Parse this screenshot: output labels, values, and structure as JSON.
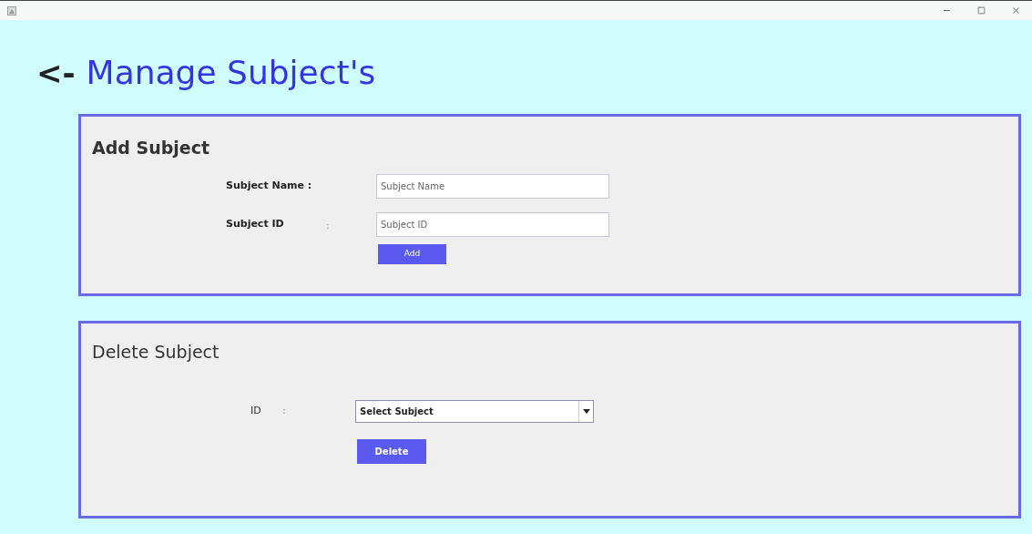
{
  "back": "<-",
  "title": "Manage Subject's",
  "add_panel": {
    "heading": "Add Subject",
    "fields": [
      {
        "label": "Subject Name :",
        "placeholder": "Subject Name"
      },
      {
        "label": "Subject ID",
        "colon": ":",
        "placeholder": "Subject ID"
      }
    ],
    "button": "Add"
  },
  "delete_panel": {
    "heading": "Delete Subject",
    "label": "ID",
    "colon": ":",
    "select": "Select Subject",
    "button": "Delete"
  }
}
